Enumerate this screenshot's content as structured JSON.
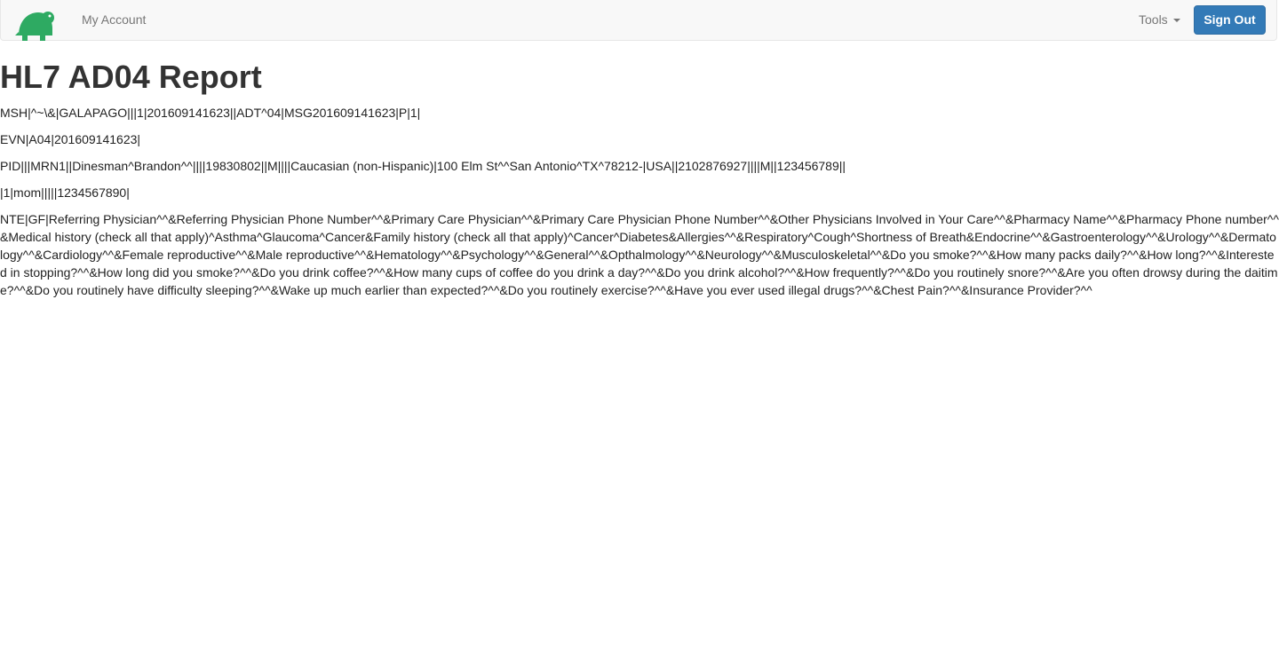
{
  "navbar": {
    "logo_icon": "turtle-logo-icon",
    "my_account_label": "My Account",
    "tools_label": "Tools",
    "sign_out_label": "Sign Out",
    "accent_color": "#337ab7",
    "logo_color": "#2eaa62"
  },
  "page": {
    "title": "HL7 AD04 Report"
  },
  "segments": {
    "msh": "MSH|^~\\&|GALAPAGO|||1|201609141623||ADT^04|MSG201609141623|P|1|",
    "evn": "EVN|A04|201609141623|",
    "pid": "PID|||MRN1||Dinesman^Brandon^^||||19830802||M||||Caucasian (non-Hispanic)|100 Elm St^^San Antonio^TX^78212-|USA||2102876927||||M||123456789||",
    "nk": "|1|mom|||||1234567890|",
    "nte": "NTE|GF|Referring Physician^^&Referring Physician Phone Number^^&Primary Care Physician^^&Primary Care Physician Phone Number^^&Other Physicians Involved in Your Care^^&Pharmacy Name^^&Pharmacy Phone number^^&Medical history (check all that apply)^Asthma^Glaucoma^Cancer&Family history (check all that apply)^Cancer^Diabetes&Allergies^^&Respiratory^Cough^Shortness of Breath&Endocrine^^&Gastroenterology^^&Urology^^&Dermatology^^&Cardiology^^&Female reproductive^^&Male reproductive^^&Hematology^^&Psychology^^&General^^&Opthalmology^^&Neurology^^&Musculoskeletal^^&Do you smoke?^^&How many packs daily?^^&How long?^^&Interested in stopping?^^&How long did you smoke?^^&Do you drink coffee?^^&How many cups of coffee do you drink a day?^^&Do you drink alcohol?^^&How frequently?^^&Do you routinely snore?^^&Are you often drowsy during the daitime?^^&Do you routinely have difficulty sleeping?^^&Wake up much earlier than expected?^^&Do you routinely exercise?^^&Have you ever used illegal drugs?^^&Chest Pain?^^&Insurance Provider?^^"
  }
}
